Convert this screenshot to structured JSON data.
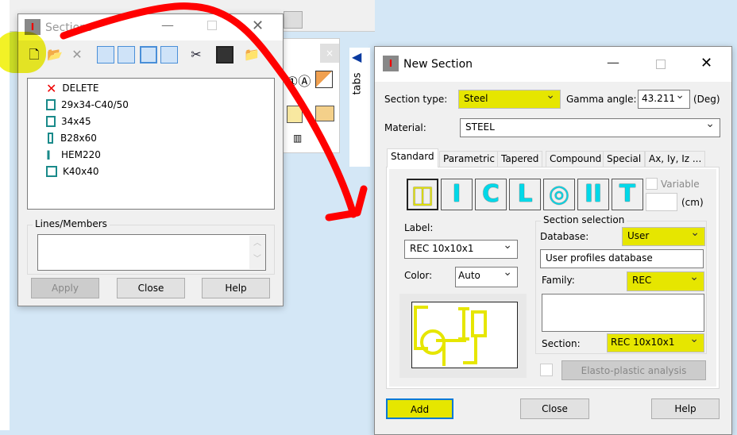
{
  "sections_window": {
    "title": "Sections",
    "list": [
      {
        "icon": "delete-icon",
        "label": "DELETE"
      },
      {
        "icon": "rect-icon",
        "label": "29x34-C40/50"
      },
      {
        "icon": "rect-icon",
        "label": "34x45"
      },
      {
        "icon": "narrow-rect-icon",
        "label": "B28x60"
      },
      {
        "icon": "i-beam-icon",
        "label": "HEM220"
      },
      {
        "icon": "rect-icon",
        "label": "K40x40"
      }
    ],
    "lines_members_label": "Lines/Members",
    "lines_members_value": "",
    "apply": "Apply",
    "close": "Close",
    "help": "Help"
  },
  "side_tabs_label": "tabs",
  "new_section": {
    "title": "New Section",
    "section_type_label": "Section type:",
    "section_type": "Steel",
    "gamma_label": "Gamma angle:",
    "gamma": "43.211",
    "gamma_unit": "(Deg)",
    "material_label": "Material:",
    "material": "STEEL",
    "tabs": [
      "Standard",
      "Parametric",
      "Tapered",
      "Compound",
      "Special",
      "Ax, Iy, Iz ..."
    ],
    "shape_icons": [
      "compound-icon",
      "i-section-icon",
      "channel-icon",
      "angle-icon",
      "tube-icon",
      "double-i-icon",
      "tee-icon"
    ],
    "variable_label": "Variable",
    "unit": "(cm)",
    "label_label": "Label:",
    "label_value": "REC 10x10x1",
    "color_label": "Color:",
    "color_value": "Auto",
    "selection_group": "Section selection",
    "database_label": "Database:",
    "database": "User",
    "database_desc": "User profiles database",
    "family_label": "Family:",
    "family": "REC",
    "section_label": "Section:",
    "section": "REC 10x10x1",
    "elasto": "Elasto-plastic analysis",
    "add": "Add",
    "close": "Close",
    "help": "Help"
  },
  "colors": {
    "highlight": "#e6e600",
    "annotation": "#ff0000"
  }
}
